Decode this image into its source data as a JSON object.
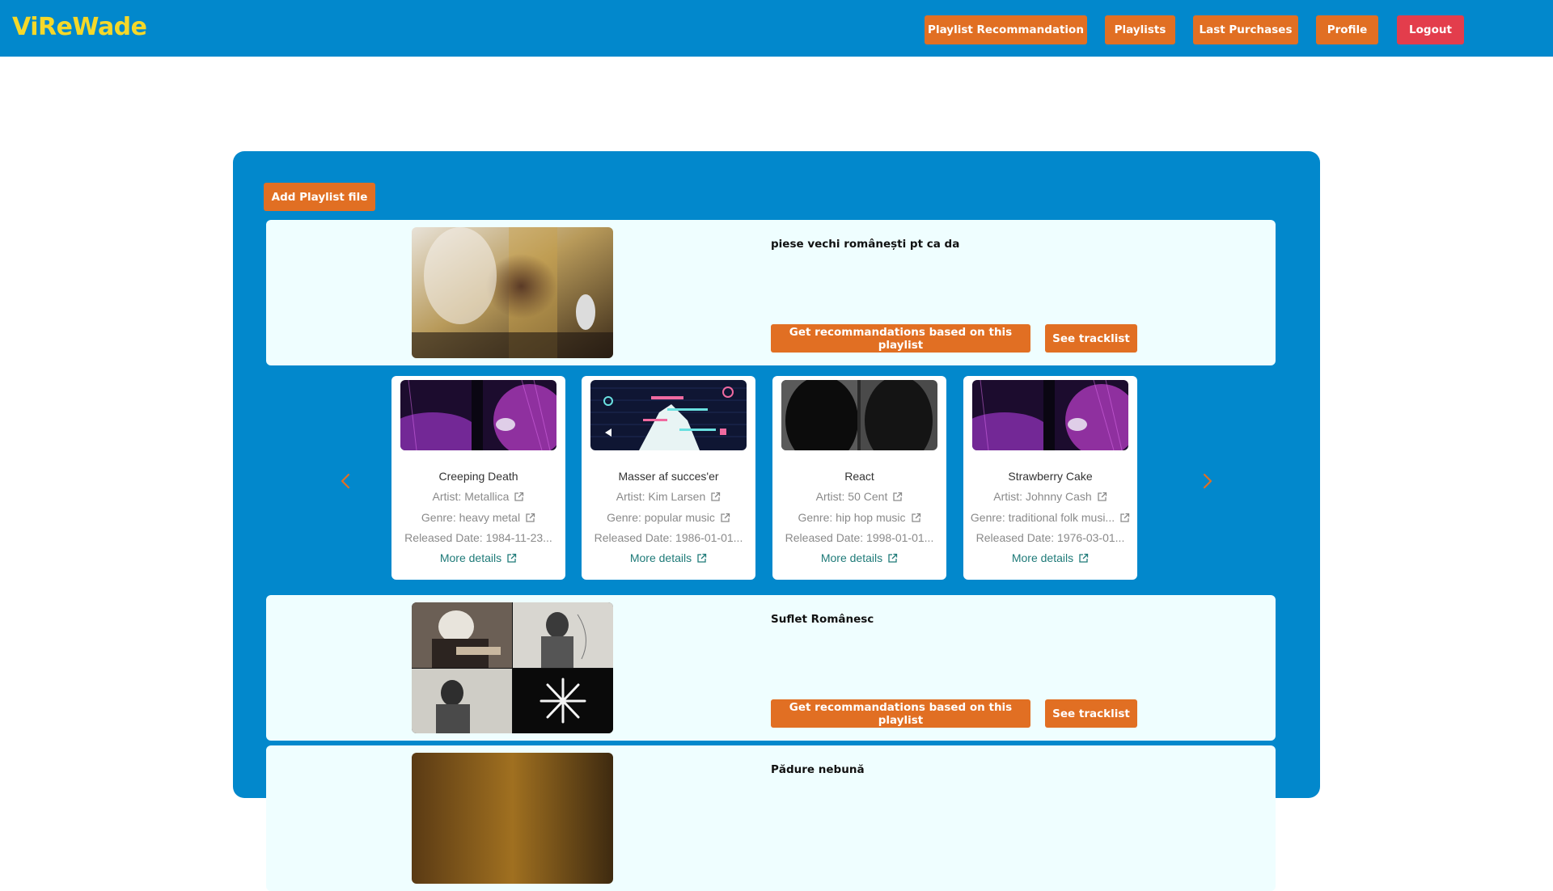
{
  "app": {
    "brand": "ViReWade"
  },
  "nav": {
    "playlist_recommandation": "Playlist Recommandation",
    "playlists": "Playlists",
    "last_purchases": "Last Purchases",
    "profile": "Profile",
    "logout": "Logout"
  },
  "main": {
    "add_playlist_label": "Add Playlist file",
    "playlists": [
      {
        "name": "piese vechi românești pt ca da",
        "rec_label": "Get recommandations based on this playlist",
        "tracklist_label": "See tracklist"
      },
      {
        "name": "Suflet Românesc",
        "rec_label": "Get recommandations based on this playlist",
        "tracklist_label": "See tracklist"
      },
      {
        "name": "Pădure nebună"
      }
    ],
    "songs": [
      {
        "title": "Creeping Death",
        "artist": "Artist: Metallica",
        "genre": "Genre: heavy metal",
        "released": "Released Date: 1984-11-23...",
        "more": "More details"
      },
      {
        "title": "Masser af succes'er",
        "artist": "Artist: Kim Larsen",
        "genre": "Genre: popular music",
        "released": "Released Date: 1986-01-01...",
        "more": "More details"
      },
      {
        "title": "React",
        "artist": "Artist: 50 Cent",
        "genre": "Genre: hip hop music",
        "released": "Released Date: 1998-01-01...",
        "more": "More details"
      },
      {
        "title": "Strawberry Cake",
        "artist": "Artist: Johnny Cash",
        "genre": "Genre: traditional folk musi...",
        "released": "Released Date: 1976-03-01...",
        "more": "More details"
      }
    ]
  },
  "icons": {
    "prev": "chevron-left-icon",
    "next": "chevron-right-icon",
    "external": "external-link-icon"
  },
  "colors": {
    "primary": "#0288cc",
    "accent": "#e16f23",
    "danger": "#e33d4c",
    "brand": "#f5d829",
    "card": "#effeff",
    "link": "#1e7a78"
  }
}
